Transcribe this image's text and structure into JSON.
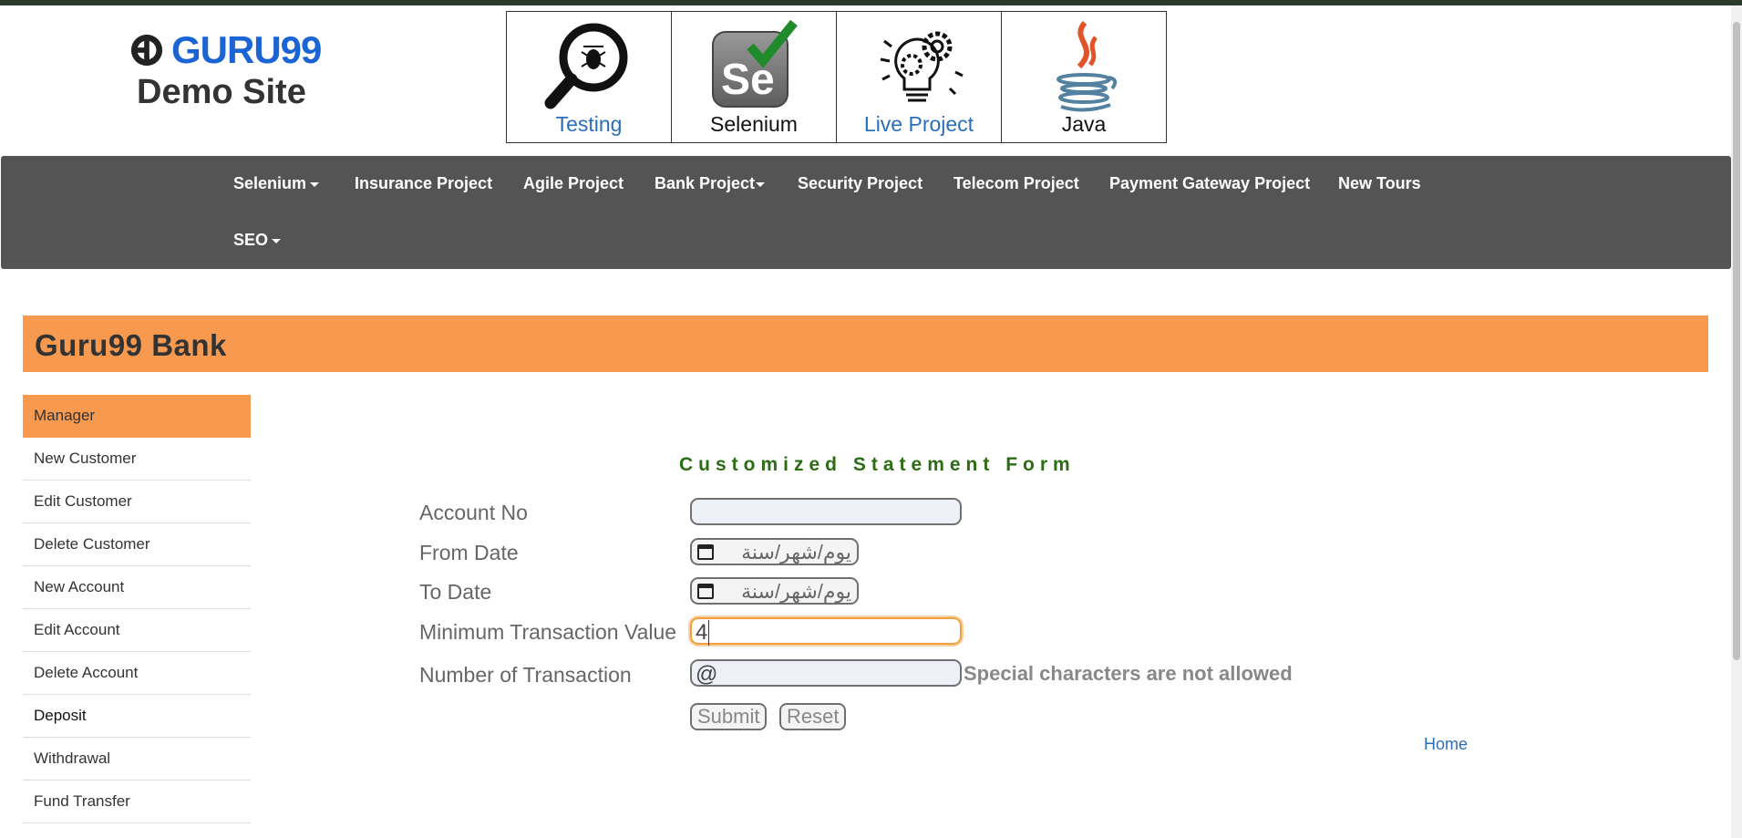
{
  "header": {
    "logo_text": "GURU99",
    "logo_subtitle": "Demo Site",
    "tiles": [
      {
        "label": "Testing",
        "icon": "magnifier-bug-icon"
      },
      {
        "label": "Selenium",
        "icon": "selenium-icon"
      },
      {
        "label": "Live Project",
        "icon": "gear-lightbulb-icon"
      },
      {
        "label": "Java",
        "icon": "java-icon"
      }
    ]
  },
  "nav": {
    "items": [
      "Selenium",
      "Insurance Project",
      "Agile Project",
      "Bank Project",
      "Security Project",
      "Telecom Project",
      "Payment Gateway Project",
      "New Tours",
      "SEO"
    ]
  },
  "bank": {
    "title": "Guru99 Bank"
  },
  "sidebar": {
    "items": [
      "Manager",
      "New Customer",
      "Edit Customer",
      "Delete Customer",
      "New Account",
      "Edit Account",
      "Delete Account",
      "Deposit",
      "Withdrawal",
      "Fund Transfer"
    ]
  },
  "form": {
    "title": "Customized Statement Form",
    "account_no_label": "Account No",
    "account_no_value": "",
    "from_date_label": "From Date",
    "from_date_placeholder": "يوم/شهر/سنة",
    "to_date_label": "To Date",
    "to_date_placeholder": "يوم/شهر/سنة",
    "min_value_label": "Minimum Transaction Value",
    "min_value_value": "4",
    "num_transactions_label": "Number of Transaction",
    "num_transactions_value": "@",
    "warning": "Special characters are not allowed",
    "submit_label": "Submit",
    "reset_label": "Reset",
    "home_link": "Home"
  },
  "colors": {
    "accent_orange": "#f79a50",
    "nav_background": "#545454",
    "form_title_green": "#2b6d14",
    "link_blue": "#2a6ebb",
    "logo_blue": "#1a64d4"
  }
}
